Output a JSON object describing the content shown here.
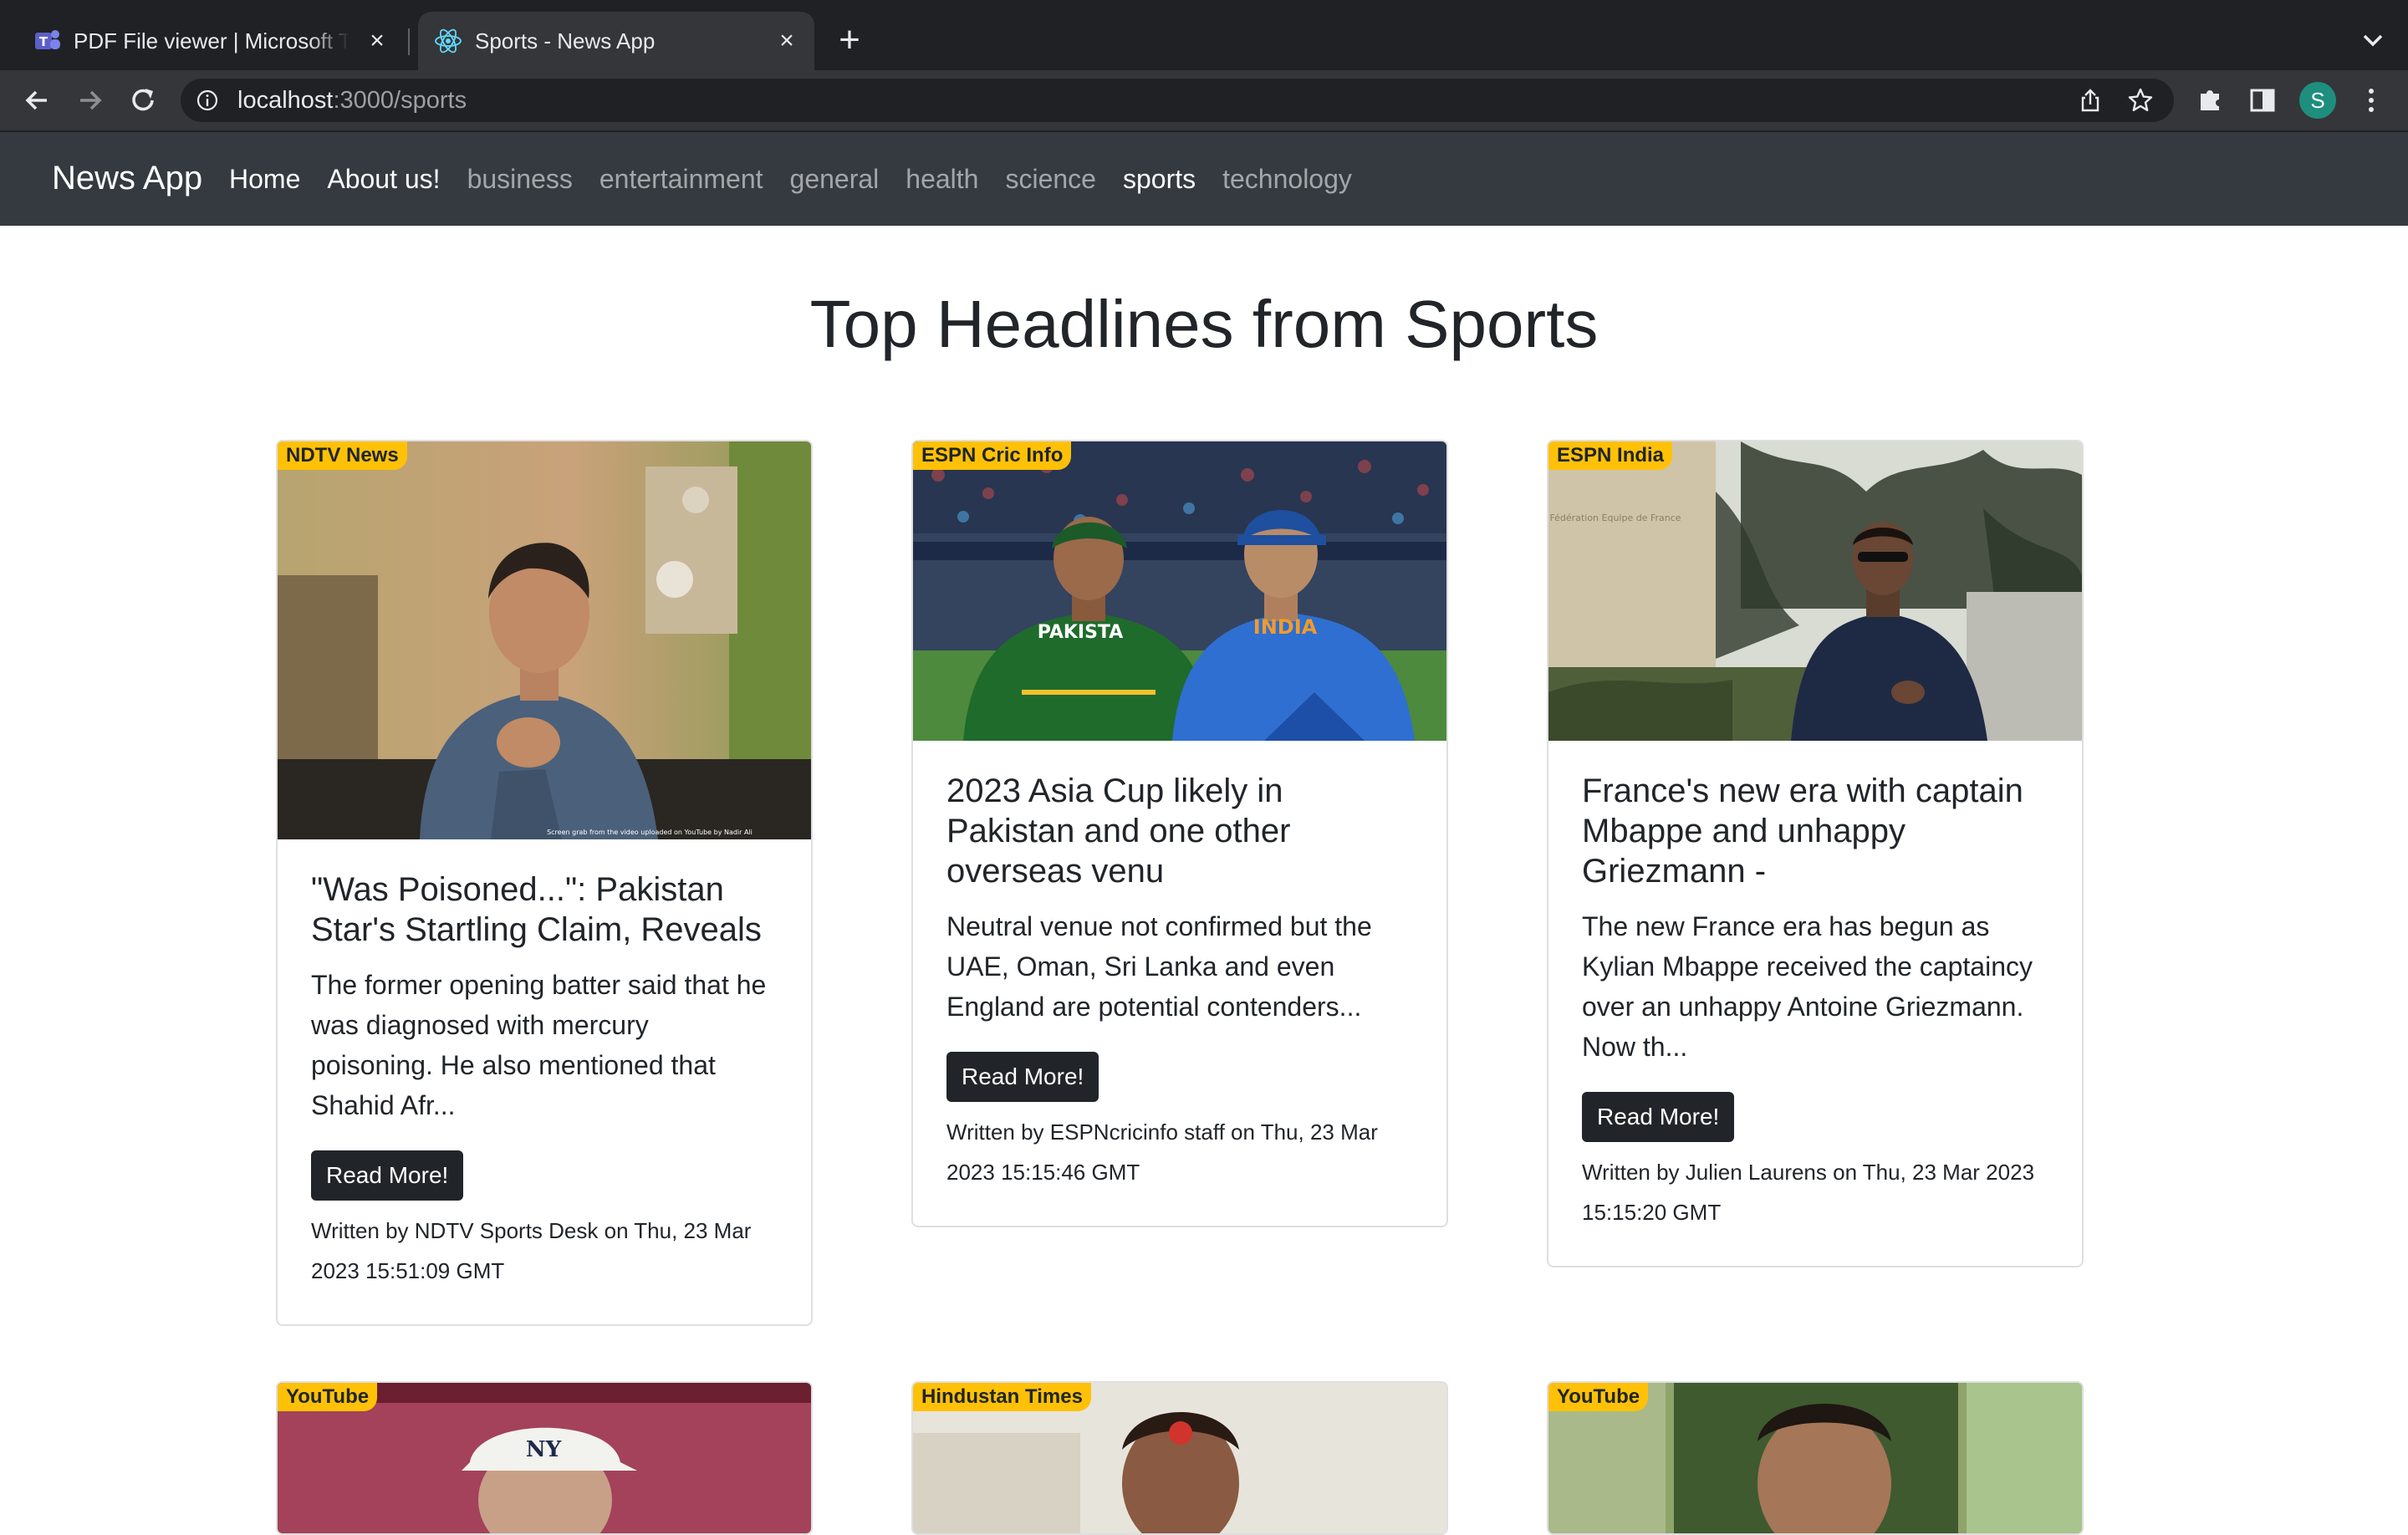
{
  "browser": {
    "tabs": [
      {
        "title": "PDF File viewer | Microsoft Teams",
        "active": false,
        "favicon": "teams-icon"
      },
      {
        "title": "Sports - News App",
        "active": true,
        "favicon": "react-icon"
      }
    ],
    "url_host": "localhost",
    "url_path": ":3000/sports",
    "profile_initial": "S"
  },
  "navbar": {
    "brand": "News App",
    "links": [
      "Home",
      "About us!",
      "business",
      "entertainment",
      "general",
      "health",
      "science",
      "sports",
      "technology"
    ]
  },
  "page": {
    "heading": "Top Headlines from Sports"
  },
  "articles": [
    {
      "source": "NDTV News",
      "title": "\"Was Poisoned...\": Pakistan Star's Startling Claim, Reveals",
      "description": "The former opening batter said that he was diagnosed with mercury poisoning. He also mentioned that Shahid Afr...",
      "button": "Read More!",
      "byline": "Written by NDTV Sports Desk on Thu, 23 Mar 2023 15:51:09 GMT",
      "image_caption": "Screen grab from the video uploaded on YouTube by Nadir Ali"
    },
    {
      "source": "ESPN Cric Info",
      "title": "2023 Asia Cup likely in Pakistan and one other overseas venu",
      "description": "Neutral venue not confirmed but the UAE, Oman, Sri Lanka and even England are potential contenders...",
      "button": "Read More!",
      "byline": "Written by ESPNcricinfo staff on Thu, 23 Mar 2023 15:15:46 GMT",
      "jersey_left": "PAKISTA",
      "jersey_right": "INDIA"
    },
    {
      "source": "ESPN India",
      "title": "France's new era with captain Mbappe and unhappy Griezmann -",
      "description": "The new France era has begun as Kylian Mbappe received the captaincy over an unhappy Antoine Griezmann. Now th...",
      "button": "Read More!",
      "byline": "Written by Julien Laurens on Thu, 23 Mar 2023 15:15:20 GMT",
      "plaque_text": "Fédération Equipe de France"
    },
    {
      "source": "YouTube"
    },
    {
      "source": "Hindustan Times"
    },
    {
      "source": "YouTube"
    }
  ]
}
